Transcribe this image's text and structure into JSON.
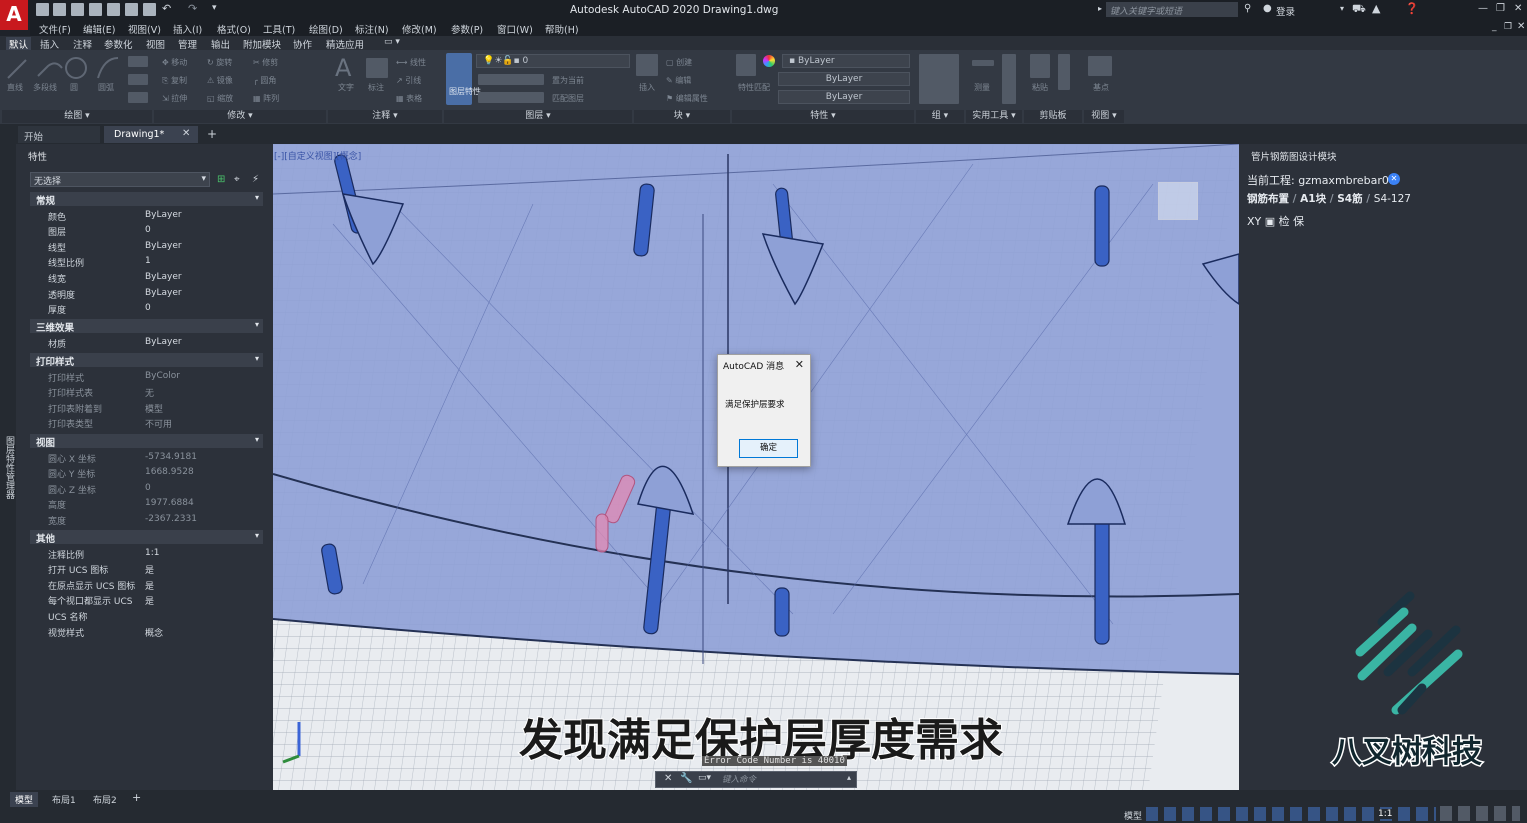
{
  "app": {
    "logo_letter": "A",
    "title": "Autodesk AutoCAD 2020    Drawing1.dwg",
    "search_placeholder": "键入关键字或短语",
    "login": "登录"
  },
  "menu": [
    "文件(F)",
    "编辑(E)",
    "视图(V)",
    "插入(I)",
    "格式(O)",
    "工具(T)",
    "绘图(D)",
    "标注(N)",
    "修改(M)",
    "参数(P)",
    "窗口(W)",
    "帮助(H)"
  ],
  "ribbon_tabs": [
    "默认",
    "插入",
    "注释",
    "参数化",
    "视图",
    "管理",
    "输出",
    "附加模块",
    "协作",
    "精选应用"
  ],
  "ribbon": {
    "panels": [
      "绘图",
      "修改",
      "注释",
      "图层",
      "块",
      "特性",
      "组",
      "实用工具",
      "剪贴板",
      "视图"
    ],
    "draw_tools": [
      "直线",
      "多段线",
      "圆",
      "圆弧"
    ],
    "modify_tools": [
      "移动",
      "旋转",
      "修剪",
      "复制",
      "镜像",
      "圆角",
      "拉伸",
      "缩放",
      "阵列"
    ],
    "annotation_tools": [
      "文字",
      "标注",
      "线性",
      "引线",
      "表格"
    ],
    "layer_tools": [
      "图层特性",
      "置为当前",
      "匹配图层"
    ],
    "layer_current": "0",
    "block_tools": [
      "插入",
      "创建",
      "编辑",
      "编辑属性"
    ],
    "property_tools": [
      "特性匹配"
    ],
    "bylayer_color": "ByLayer",
    "bylayer_linetype": "ByLayer",
    "bylayer_lineweight": "ByLayer",
    "group_label": "组",
    "measure_label": "测量",
    "paste_label": "粘贴",
    "base_label": "基点"
  },
  "doc_tabs": {
    "start": "开始",
    "drawing": "Drawing1*"
  },
  "properties": {
    "title": "特性",
    "selection": "无选择",
    "sections": [
      {
        "name": "常规",
        "rows": [
          {
            "name": "颜色",
            "value": "ByLayer"
          },
          {
            "name": "图层",
            "value": "0"
          },
          {
            "name": "线型",
            "value": "ByLayer"
          },
          {
            "name": "线型比例",
            "value": "1"
          },
          {
            "name": "线宽",
            "value": "ByLayer"
          },
          {
            "name": "透明度",
            "value": "ByLayer"
          },
          {
            "name": "厚度",
            "value": "0"
          }
        ]
      },
      {
        "name": "三维效果",
        "rows": [
          {
            "name": "材质",
            "value": "ByLayer"
          }
        ]
      },
      {
        "name": "打印样式",
        "rows": [
          {
            "name": "打印样式",
            "value": "ByColor"
          },
          {
            "name": "打印样式表",
            "value": "无"
          },
          {
            "name": "打印表附着到",
            "value": "模型"
          },
          {
            "name": "打印表类型",
            "value": "不可用"
          }
        ]
      },
      {
        "name": "视图",
        "rows": [
          {
            "name": "圆心 X 坐标",
            "value": "-5734.9181"
          },
          {
            "name": "圆心 Y 坐标",
            "value": "1668.9528"
          },
          {
            "name": "圆心 Z 坐标",
            "value": "0"
          },
          {
            "name": "高度",
            "value": "1977.6884"
          },
          {
            "name": "宽度",
            "value": "-2367.2331"
          }
        ]
      },
      {
        "name": "其他",
        "rows": [
          {
            "name": "注释比例",
            "value": "1:1"
          },
          {
            "name": "打开 UCS 图标",
            "value": "是"
          },
          {
            "name": "在原点显示 UCS 图标",
            "value": "是"
          },
          {
            "name": "每个视口都显示 UCS",
            "value": "是"
          },
          {
            "name": "UCS 名称",
            "value": ""
          },
          {
            "name": "视觉样式",
            "value": "概念"
          }
        ]
      }
    ]
  },
  "left_strip_label": "图层特性管理器",
  "viewport_label": "[-][自定义视图][概念]",
  "right_panel": {
    "title": "管片钢筋图设计模块",
    "project_label": "当前工程:",
    "project_value": "gzmaxmbrebar01",
    "breadcrumb": [
      "钢筋布置",
      "A1块",
      "S4筋",
      "S4-127"
    ],
    "tools": [
      "XY",
      "检",
      "保"
    ],
    "brand": "八叉树科技",
    "brand_color": "#3ab5a4"
  },
  "dialog": {
    "title": "AutoCAD 消息",
    "message": "满足保护层要求",
    "ok": "确定"
  },
  "subtitle": "发现满足保护层厚度需求",
  "command": {
    "placeholder": "键入命令",
    "error": "Error Code Number is 40010"
  },
  "status": {
    "tabs": [
      "模型",
      "布局1",
      "布局2"
    ],
    "model": "模型",
    "scale": "1:1"
  },
  "colors": {
    "accent": "#3b4250",
    "segment_fill": "#8ea0d6",
    "rebar": "#3a62c4",
    "highlight": "#e38ab3"
  }
}
